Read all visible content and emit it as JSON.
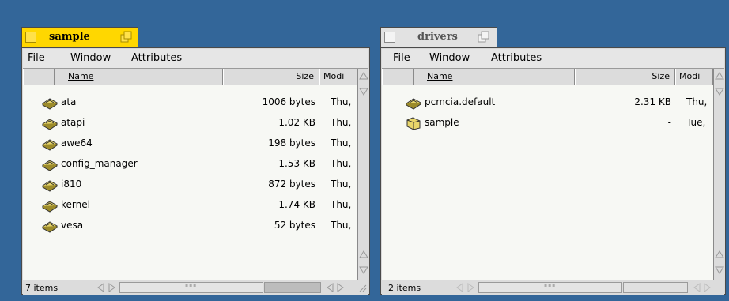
{
  "menu": [
    "File",
    "Window",
    "Attributes"
  ],
  "columns": {
    "name": "Name",
    "size": "Size",
    "modified": "Modi"
  },
  "windows": [
    {
      "title": "sample",
      "status": "7 items",
      "files": [
        {
          "name": "ata",
          "size": "1006 bytes",
          "modified": "Thu,"
        },
        {
          "name": "atapi",
          "size": "1.02 KB",
          "modified": "Thu,"
        },
        {
          "name": "awe64",
          "size": "198 bytes",
          "modified": "Thu,"
        },
        {
          "name": "config_manager",
          "size": "1.53 KB",
          "modified": "Thu,"
        },
        {
          "name": "i810",
          "size": "872 bytes",
          "modified": "Thu,"
        },
        {
          "name": "kernel",
          "size": "1.74 KB",
          "modified": "Thu,"
        },
        {
          "name": "vesa",
          "size": "52 bytes",
          "modified": "Thu,"
        }
      ]
    },
    {
      "title": "drivers",
      "status": "2 items",
      "files": [
        {
          "name": "pcmcia.default",
          "size": "2.31 KB",
          "modified": "Thu,"
        },
        {
          "name": "sample",
          "size": "-",
          "modified": "Tue,"
        }
      ]
    }
  ]
}
